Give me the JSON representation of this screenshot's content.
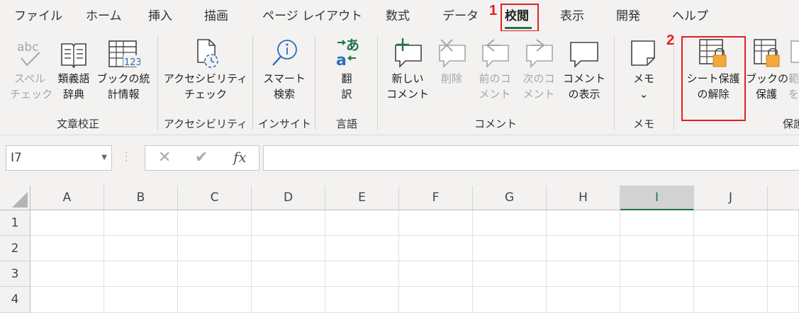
{
  "tabs": [
    {
      "label": "ファイル",
      "active": false
    },
    {
      "label": "ホーム",
      "active": false
    },
    {
      "label": "挿入",
      "active": false
    },
    {
      "label": "描画",
      "active": false
    },
    {
      "label": "ページ レイアウト",
      "active": false
    },
    {
      "label": "数式",
      "active": false
    },
    {
      "label": "データ",
      "active": false
    },
    {
      "label": "校閲",
      "active": true
    },
    {
      "label": "表示",
      "active": false
    },
    {
      "label": "開発",
      "active": false
    },
    {
      "label": "ヘルプ",
      "active": false
    }
  ],
  "annotations": {
    "step1": "1",
    "step2": "2",
    "color": "#e02020"
  },
  "ribbon": {
    "groups": {
      "proofing": "文章校正",
      "accessibility": "アクセシビリティ",
      "insights": "インサイト",
      "language": "言語",
      "comments": "コメント",
      "notes": "メモ",
      "protect": "保護"
    },
    "buttons": {
      "spelling": {
        "line1": "スペル",
        "line2": "チェック",
        "enabled": false
      },
      "thesaurus": {
        "line1": "類義語",
        "line2": "辞典",
        "enabled": true
      },
      "workbook_stats": {
        "line1": "ブックの統",
        "line2": "計情報",
        "enabled": true
      },
      "check_accessibility": {
        "line1": "アクセシビリティ",
        "line2": "チェック",
        "enabled": true
      },
      "smart_lookup": {
        "line1": "スマート",
        "line2": "検索",
        "enabled": true
      },
      "translate": {
        "line1": "翻",
        "line2": "訳",
        "enabled": true
      },
      "new_comment": {
        "line1": "新しい",
        "line2": "コメント",
        "enabled": true
      },
      "delete_comment": {
        "line1": "削除",
        "line2": "",
        "enabled": false
      },
      "previous_comment": {
        "line1": "前のコ",
        "line2": "メント",
        "enabled": false
      },
      "next_comment": {
        "line1": "次のコ",
        "line2": "メント",
        "enabled": false
      },
      "show_comments": {
        "line1": "コメント",
        "line2": "の表示",
        "enabled": true
      },
      "notes": {
        "line1": "メモ",
        "line2": "⌄",
        "enabled": true
      },
      "unprotect_sheet": {
        "line1": "シート保護",
        "line2": "の解除",
        "enabled": true
      },
      "protect_workbook": {
        "line1": "ブックの",
        "line2": "保護",
        "enabled": true
      },
      "allow_edit_ranges": {
        "line1": "範",
        "line2": "を",
        "enabled": false
      }
    },
    "icon_text": {
      "abc": "abc",
      "stats_number": "123",
      "translate_a1": "a",
      "translate_a2": "あ"
    }
  },
  "formula_bar": {
    "name_box": "I7",
    "cancel": "✕",
    "enter": "✔",
    "fx": "fx",
    "value": ""
  },
  "grid": {
    "columns": [
      "A",
      "B",
      "C",
      "D",
      "E",
      "F",
      "G",
      "H",
      "I",
      "J"
    ],
    "selected_column": "I",
    "rows": [
      "1",
      "2",
      "3",
      "4"
    ],
    "accent": "#217346"
  }
}
